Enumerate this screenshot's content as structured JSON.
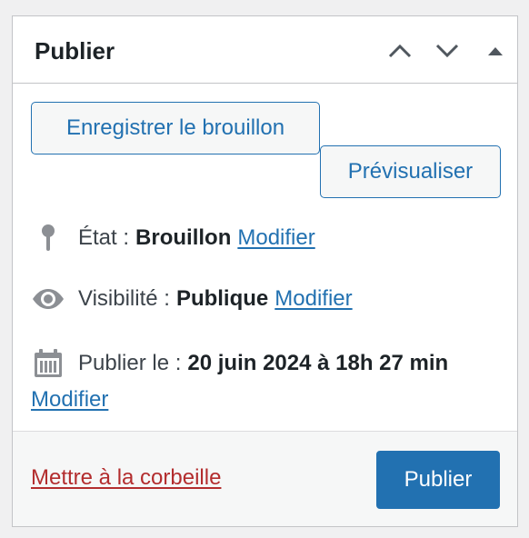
{
  "header": {
    "title": "Publier",
    "controls": {
      "move_up_icon": "chevron-up-icon",
      "move_down_icon": "chevron-down-icon",
      "toggle_icon": "triangle-up-icon"
    }
  },
  "actions": {
    "save_draft_label": "Enregistrer le brouillon",
    "preview_label": "Prévisualiser"
  },
  "status": {
    "icon": "pin-icon",
    "label": "État :",
    "value": "Brouillon",
    "edit_label": "Modifier"
  },
  "visibility": {
    "icon": "eye-icon",
    "label": "Visibilité :",
    "value": "Publique",
    "edit_label": "Modifier"
  },
  "schedule": {
    "icon": "calendar-icon",
    "label": "Publier le :",
    "value": "20 juin 2024 à 18h 27 min",
    "edit_label": "Modifier"
  },
  "footer": {
    "trash_label": "Mettre à la corbeille",
    "publish_label": "Publier"
  },
  "colors": {
    "accent": "#2271b1",
    "danger": "#b32d2e",
    "text": "#1d2327",
    "muted": "#3c434a",
    "background": "#f0f0f1"
  }
}
